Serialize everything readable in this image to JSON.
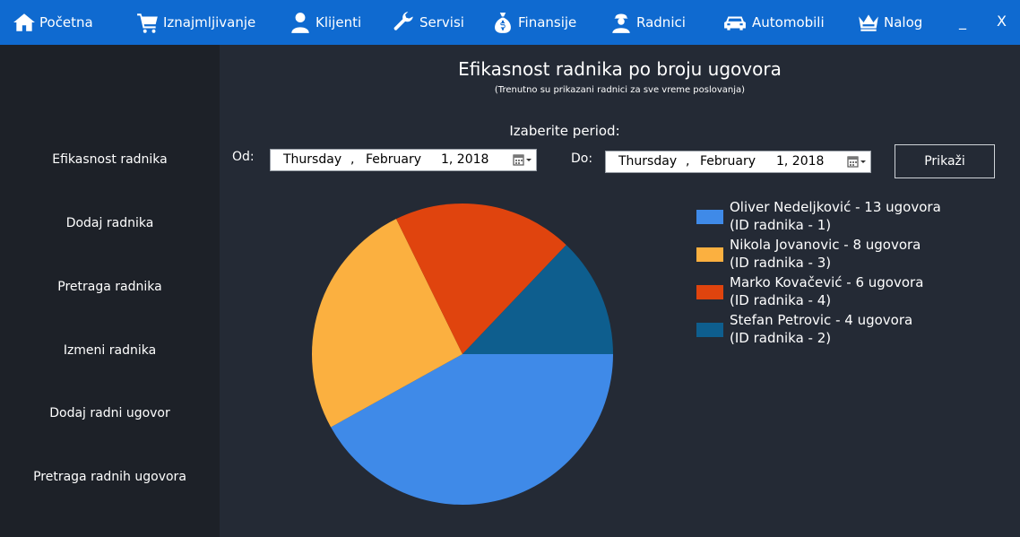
{
  "nav": {
    "items": [
      {
        "label": "Početna",
        "icon": "home-icon"
      },
      {
        "label": "Iznajmljivanje",
        "icon": "cart-icon"
      },
      {
        "label": "Klijenti",
        "icon": "person-icon"
      },
      {
        "label": "Servisi",
        "icon": "wrench-icon"
      },
      {
        "label": "Finansije",
        "icon": "money-bag-icon"
      },
      {
        "label": "Radnici",
        "icon": "worker-icon"
      },
      {
        "label": "Automobili",
        "icon": "car-icon"
      },
      {
        "label": "Nalog",
        "icon": "crown-icon"
      }
    ],
    "minimize": "_",
    "close": "X"
  },
  "sidebar": {
    "items": [
      {
        "label": "Efikasnost radnika"
      },
      {
        "label": "Dodaj radnika"
      },
      {
        "label": "Pretraga radnika"
      },
      {
        "label": "Izmeni radnika"
      },
      {
        "label": "Dodaj radni ugovor"
      },
      {
        "label": "Pretraga radnih ugovora"
      }
    ]
  },
  "main": {
    "title": "Efikasnost radnika po broju ugovora",
    "subtitle": "(Trenutno su prikazani radnici za sve vreme poslovanja)",
    "period_label": "Izaberite period:",
    "from": {
      "label": "Od:",
      "weekday": "Thursday",
      "sep1": ",",
      "month": "February",
      "day_year": "1, 2018"
    },
    "to": {
      "label": "Do:",
      "weekday": "Thursday",
      "sep1": ",",
      "month": "February",
      "day_year": "1, 2018"
    },
    "show_button": "Prikaži"
  },
  "chart_data": {
    "type": "pie",
    "title": "Efikasnost radnika po broju ugovora",
    "series": [
      {
        "name": "Oliver Nedeljković - 13 ugovora",
        "sub": "(ID radnika - 1)",
        "value": 13,
        "color": "#3f8ae8"
      },
      {
        "name": "Nikola Jovanovic - 8 ugovora",
        "sub": "(ID radnika - 3)",
        "value": 8,
        "color": "#fbb040"
      },
      {
        "name": "Marko Kovačević - 6 ugovora",
        "sub": "(ID radnika - 4)",
        "value": 6,
        "color": "#e0440e"
      },
      {
        "name": "Stefan Petrovic - 4 ugovora",
        "sub": "(ID radnika - 2)",
        "value": 4,
        "color": "#0e5e8e"
      }
    ],
    "legend_position": "right"
  }
}
